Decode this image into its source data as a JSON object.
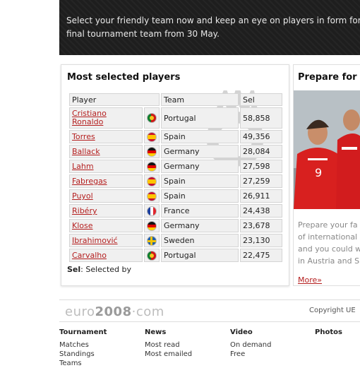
{
  "banner": {
    "line1": "Select your friendly team now and keep an eye on players in form for UE",
    "line2": "final tournament team from 30 May."
  },
  "most_selected": {
    "title": "Most selected players",
    "headers": {
      "player": "Player",
      "team": "Team",
      "sel": "Sel"
    },
    "rows": [
      {
        "player": "Cristiano Ronaldo",
        "flag": "pt",
        "team": "Portugal",
        "sel": "58,858"
      },
      {
        "player": "Torres",
        "flag": "es",
        "team": "Spain",
        "sel": "49,356"
      },
      {
        "player": "Ballack",
        "flag": "de",
        "team": "Germany",
        "sel": "28,084"
      },
      {
        "player": "Lahm",
        "flag": "de",
        "team": "Germany",
        "sel": "27,598"
      },
      {
        "player": "Fabregas",
        "flag": "es",
        "team": "Spain",
        "sel": "27,259"
      },
      {
        "player": "Puyol",
        "flag": "es",
        "team": "Spain",
        "sel": "26,911"
      },
      {
        "player": "Ribéry",
        "flag": "fr",
        "team": "France",
        "sel": "24,438"
      },
      {
        "player": "Klose",
        "flag": "de",
        "team": "Germany",
        "sel": "23,678"
      },
      {
        "player": "Ibrahimović",
        "flag": "se",
        "team": "Sweden",
        "sel": "23,130"
      },
      {
        "player": "Carvalho",
        "flag": "pt",
        "team": "Portugal",
        "sel": "22,475"
      }
    ],
    "legend_key": "Sel",
    "legend_text": ": Selected by"
  },
  "prepare": {
    "title": "Prepare for M",
    "text_lines": [
      "Prepare your fa",
      "of international",
      "and you could w",
      "in Austria and S"
    ],
    "more": "More»"
  },
  "footer": {
    "logo_left": "euro",
    "logo_bold": "2008",
    "logo_right": "·com",
    "copyright": "Copyright UE",
    "columns": [
      {
        "heading": "Tournament",
        "links": [
          "Matches",
          "Standings",
          "Teams"
        ]
      },
      {
        "heading": "News",
        "links": [
          "Most read",
          "Most emailed"
        ]
      },
      {
        "heading": "Video",
        "links": [
          "On demand",
          "Free"
        ]
      },
      {
        "heading": "Photos",
        "links": []
      }
    ]
  },
  "colors": {
    "link": "#b41e1e",
    "banner_bg": "#1e1e1e"
  }
}
